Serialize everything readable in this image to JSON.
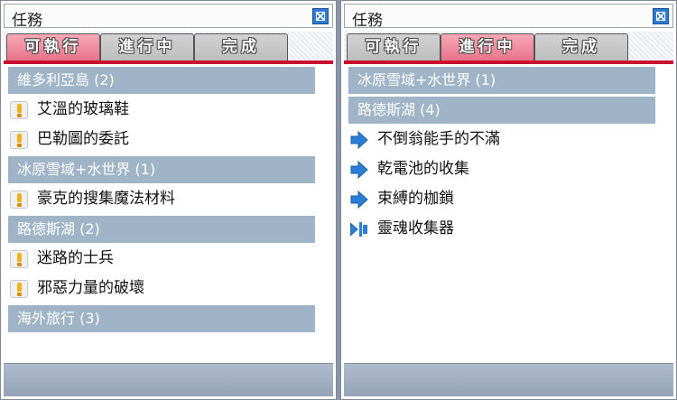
{
  "panels": [
    {
      "title": "任務",
      "tabs": [
        {
          "label": "可執行",
          "active": true
        },
        {
          "label": "進行中",
          "active": false
        },
        {
          "label": "完成",
          "active": false
        }
      ],
      "items": [
        {
          "type": "category",
          "label": "維多利亞島 (2)"
        },
        {
          "type": "quest",
          "icon": "exclamation-icon",
          "label": "艾溫的玻璃鞋"
        },
        {
          "type": "quest",
          "icon": "exclamation-icon",
          "label": "巴勒圖的委託"
        },
        {
          "type": "category",
          "label": "冰原雪域+水世界 (1)"
        },
        {
          "type": "quest",
          "icon": "exclamation-icon",
          "label": "豪克的搜集魔法材料"
        },
        {
          "type": "category",
          "label": "路德斯湖 (2)"
        },
        {
          "type": "quest",
          "icon": "exclamation-icon",
          "label": "迷路的士兵"
        },
        {
          "type": "quest",
          "icon": "exclamation-icon",
          "label": "邪惡力量的破壞"
        },
        {
          "type": "category",
          "label": "海外旅行 (3)"
        }
      ]
    },
    {
      "title": "任務",
      "tabs": [
        {
          "label": "可執行",
          "active": false
        },
        {
          "label": "進行中",
          "active": true
        },
        {
          "label": "完成",
          "active": false
        }
      ],
      "items": [
        {
          "type": "category",
          "label": "冰原雪域+水世界 (1)"
        },
        {
          "type": "category",
          "label": "路德斯湖 (4)"
        },
        {
          "type": "quest",
          "icon": "arrow-right-icon",
          "label": "不倒翁能手的不滿"
        },
        {
          "type": "quest",
          "icon": "arrow-right-icon",
          "label": "乾電池的收集"
        },
        {
          "type": "quest",
          "icon": "arrow-right-icon",
          "label": "束縛的枷鎖"
        },
        {
          "type": "quest",
          "icon": "arrow-right-bar-icon",
          "label": "靈魂收集器"
        }
      ]
    }
  ],
  "colors": {
    "accent": "#c8102e",
    "category_bg": "#9fb4c7",
    "active_tab": "#e8738a",
    "inactive_tab": "#bdbdbd",
    "close_button": "#2f7bd4",
    "icon_blue": "#2a7fd4",
    "icon_orange": "#f2b11a"
  }
}
